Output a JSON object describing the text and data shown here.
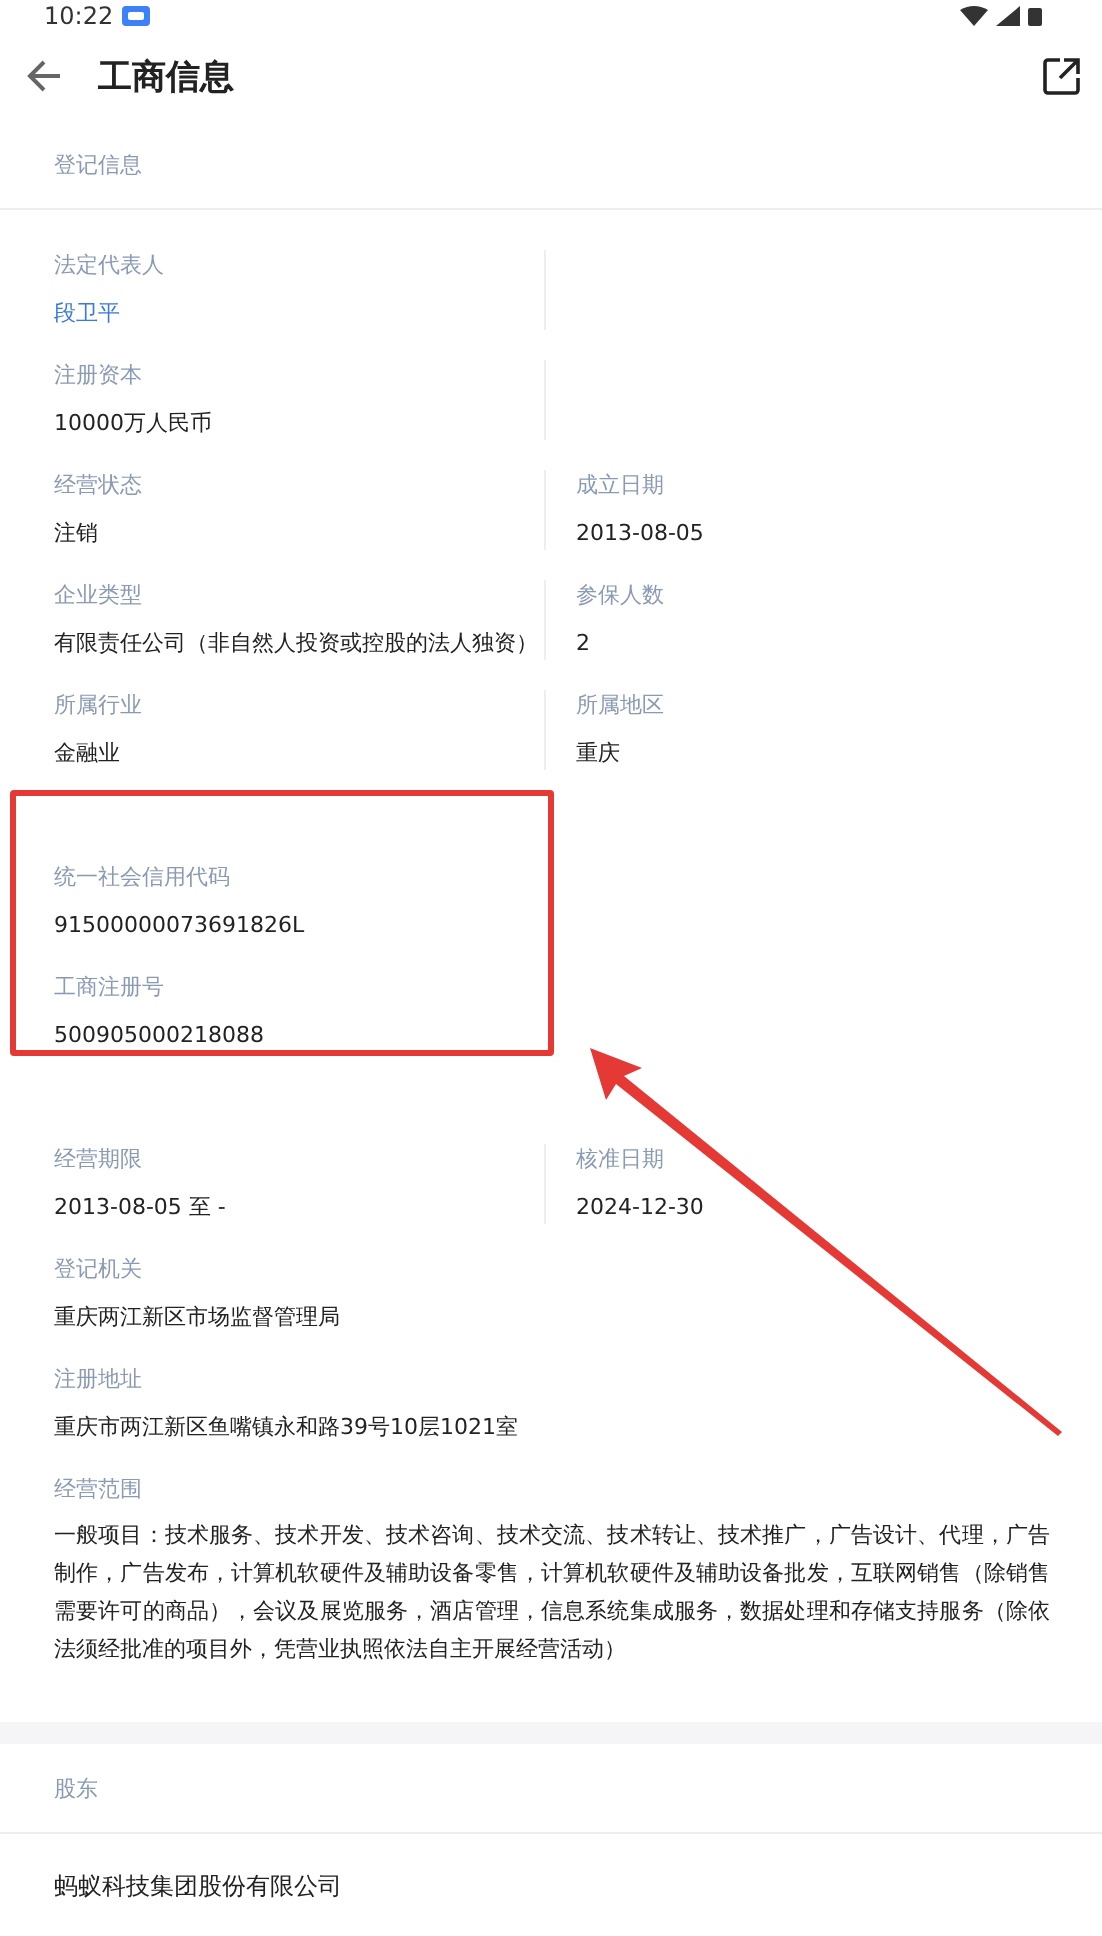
{
  "status_bar": {
    "time": "10:22"
  },
  "header": {
    "title": "工商信息"
  },
  "sections": [
    {
      "title": "登记信息",
      "kind": "fields",
      "groups": [
        {
          "rows": [
            {
              "kind": "pair",
              "cells": [
                {
                  "label": "法定代表人",
                  "value": "段卫平",
                  "link": true
                }
              ]
            },
            {
              "kind": "pair",
              "cells": [
                {
                  "label": "注册资本",
                  "value": "10000万人民币",
                  "link": false
                }
              ]
            },
            {
              "kind": "pair",
              "cells": [
                {
                  "label": "经营状态",
                  "value": "注销",
                  "link": false
                },
                {
                  "label": "成立日期",
                  "value": "2013-08-05",
                  "link": false
                }
              ]
            },
            {
              "kind": "pair",
              "cells": [
                {
                  "label": "企业类型",
                  "value": "有限责任公司（非自然人投资或控股的法人独资）",
                  "link": false
                },
                {
                  "label": "参保人数",
                  "value": "2",
                  "link": false
                }
              ]
            },
            {
              "kind": "pair",
              "cells": [
                {
                  "label": "所属行业",
                  "value": "金融业",
                  "link": false
                },
                {
                  "label": "所属地区",
                  "value": "重庆",
                  "link": false
                }
              ]
            }
          ]
        },
        {
          "highlighted": true,
          "rows": [
            {
              "kind": "full",
              "cells": [
                {
                  "label": "统一社会信用代码",
                  "value": "91500000073691826L",
                  "link": false
                }
              ]
            },
            {
              "kind": "full",
              "cells": [
                {
                  "label": "工商注册号",
                  "value": "500905000218088",
                  "link": false
                }
              ]
            }
          ]
        },
        {
          "rows": [
            {
              "kind": "pair",
              "cells": [
                {
                  "label": "经营期限",
                  "value": "2013-08-05 至 -",
                  "link": false
                },
                {
                  "label": "核准日期",
                  "value": "2024-12-30",
                  "link": false
                }
              ]
            },
            {
              "kind": "full",
              "cells": [
                {
                  "label": "登记机关",
                  "value": "重庆两江新区市场监督管理局",
                  "link": false
                }
              ]
            },
            {
              "kind": "full",
              "cells": [
                {
                  "label": "注册地址",
                  "value": "重庆市两江新区鱼嘴镇永和路39号10层1021室",
                  "link": false
                }
              ]
            },
            {
              "kind": "paragraph",
              "cells": [
                {
                  "label": "经营范围",
                  "value": "一般项目：技术服务、技术开发、技术咨询、技术交流、技术转让、技术推广，广告设计、代理，广告制作，广告发布，计算机软硬件及辅助设备零售，计算机软硬件及辅助设备批发，互联网销售（除销售需要许可的商品），会议及展览服务，酒店管理，信息系统集成服务，数据处理和存储支持服务（除依法须经批准的项目外，凭营业执照依法自主开展经营活动）",
                  "link": false
                }
              ]
            }
          ]
        }
      ]
    },
    {
      "title": "股东",
      "kind": "list",
      "items": [
        "蚂蚁科技集团股份有限公司"
      ]
    }
  ]
}
